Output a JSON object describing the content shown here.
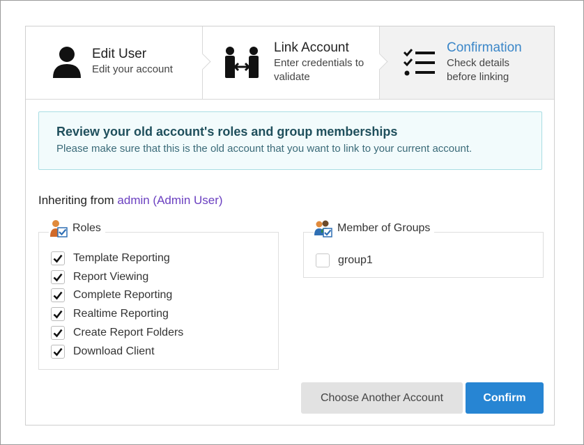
{
  "wizard": {
    "steps": [
      {
        "title": "Edit User",
        "desc": "Edit your account",
        "icon": "user-icon"
      },
      {
        "title": "Link Account",
        "desc": "Enter credentials to validate",
        "icon": "link-account-icon"
      },
      {
        "title": "Confirmation",
        "desc": "Check details before linking",
        "icon": "checklist-icon",
        "active": true
      }
    ]
  },
  "info": {
    "title": "Review your old account's roles and group memberships",
    "text": "Please make sure that this is the old account that you want to link to your current account."
  },
  "inherit": {
    "prefix": "Inheriting from",
    "user": "admin (Admin User)"
  },
  "roles": {
    "legend": "Roles",
    "icon": "user-role-icon",
    "items": [
      {
        "label": "Template Reporting",
        "checked": true
      },
      {
        "label": "Report Viewing",
        "checked": true
      },
      {
        "label": "Complete Reporting",
        "checked": true
      },
      {
        "label": "Realtime Reporting",
        "checked": true
      },
      {
        "label": "Create Report Folders",
        "checked": true
      },
      {
        "label": "Download Client",
        "checked": true
      }
    ]
  },
  "groups": {
    "legend": "Member of Groups",
    "icon": "group-icon",
    "items": [
      {
        "label": "group1",
        "checked": false
      }
    ]
  },
  "buttons": {
    "choose_another": "Choose Another Account",
    "confirm": "Confirm"
  },
  "colors": {
    "accent": "#2785d3",
    "active_step": "#3a86c8",
    "info_border": "#a9dde3",
    "info_bg": "#f2fbfc",
    "user_link": "#6a3fc0"
  }
}
